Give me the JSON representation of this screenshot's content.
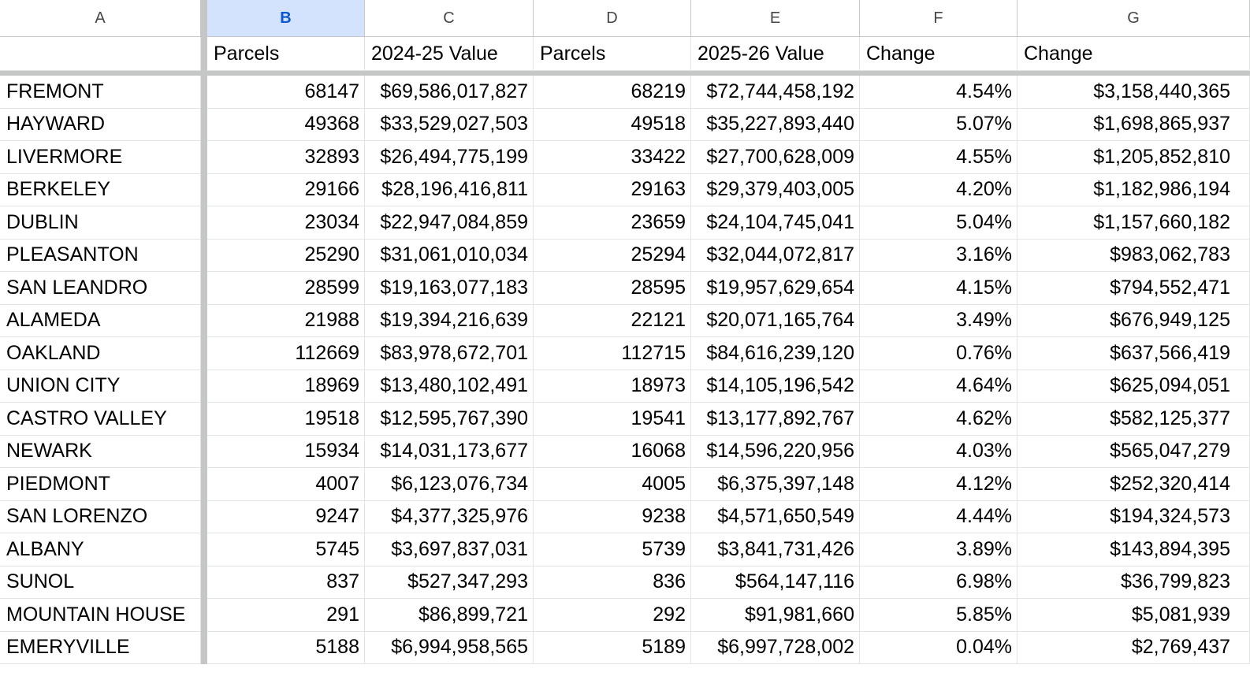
{
  "columns": [
    "A",
    "B",
    "C",
    "D",
    "E",
    "F",
    "G"
  ],
  "selected_column": "B",
  "headers": [
    "",
    "Parcels",
    "2024-25 Value",
    "Parcels",
    "2025-26 Value",
    "Change",
    "Change"
  ],
  "rows": [
    [
      "FREMONT",
      "68147",
      "$69,586,017,827",
      "68219",
      "$72,744,458,192",
      "4.54%",
      "$3,158,440,365"
    ],
    [
      "HAYWARD",
      "49368",
      "$33,529,027,503",
      "49518",
      "$35,227,893,440",
      "5.07%",
      "$1,698,865,937"
    ],
    [
      "LIVERMORE",
      "32893",
      "$26,494,775,199",
      "33422",
      "$27,700,628,009",
      "4.55%",
      "$1,205,852,810"
    ],
    [
      "BERKELEY",
      "29166",
      "$28,196,416,811",
      "29163",
      "$29,379,403,005",
      "4.20%",
      "$1,182,986,194"
    ],
    [
      "DUBLIN",
      "23034",
      "$22,947,084,859",
      "23659",
      "$24,104,745,041",
      "5.04%",
      "$1,157,660,182"
    ],
    [
      "PLEASANTON",
      "25290",
      "$31,061,010,034",
      "25294",
      "$32,044,072,817",
      "3.16%",
      "$983,062,783"
    ],
    [
      "SAN LEANDRO",
      "28599",
      "$19,163,077,183",
      "28595",
      "$19,957,629,654",
      "4.15%",
      "$794,552,471"
    ],
    [
      "ALAMEDA",
      "21988",
      "$19,394,216,639",
      "22121",
      "$20,071,165,764",
      "3.49%",
      "$676,949,125"
    ],
    [
      "OAKLAND",
      "112669",
      "$83,978,672,701",
      "112715",
      "$84,616,239,120",
      "0.76%",
      "$637,566,419"
    ],
    [
      "UNION CITY",
      "18969",
      "$13,480,102,491",
      "18973",
      "$14,105,196,542",
      "4.64%",
      "$625,094,051"
    ],
    [
      "CASTRO VALLEY",
      "19518",
      "$12,595,767,390",
      "19541",
      "$13,177,892,767",
      "4.62%",
      "$582,125,377"
    ],
    [
      "NEWARK",
      "15934",
      "$14,031,173,677",
      "16068",
      "$14,596,220,956",
      "4.03%",
      "$565,047,279"
    ],
    [
      "PIEDMONT",
      "4007",
      "$6,123,076,734",
      "4005",
      "$6,375,397,148",
      "4.12%",
      "$252,320,414"
    ],
    [
      "SAN LORENZO",
      "9247",
      "$4,377,325,976",
      "9238",
      "$4,571,650,549",
      "4.44%",
      "$194,324,573"
    ],
    [
      "ALBANY",
      "5745",
      "$3,697,837,031",
      "5739",
      "$3,841,731,426",
      "3.89%",
      "$143,894,395"
    ],
    [
      "SUNOL",
      "837",
      "$527,347,293",
      "836",
      "$564,147,116",
      "6.98%",
      "$36,799,823"
    ],
    [
      "MOUNTAIN HOUSE",
      "291",
      "$86,899,721",
      "292",
      "$91,981,660",
      "5.85%",
      "$5,081,939"
    ],
    [
      "EMERYVILLE",
      "5188",
      "$6,994,958,565",
      "5189",
      "$6,997,728,002",
      "0.04%",
      "$2,769,437"
    ]
  ]
}
